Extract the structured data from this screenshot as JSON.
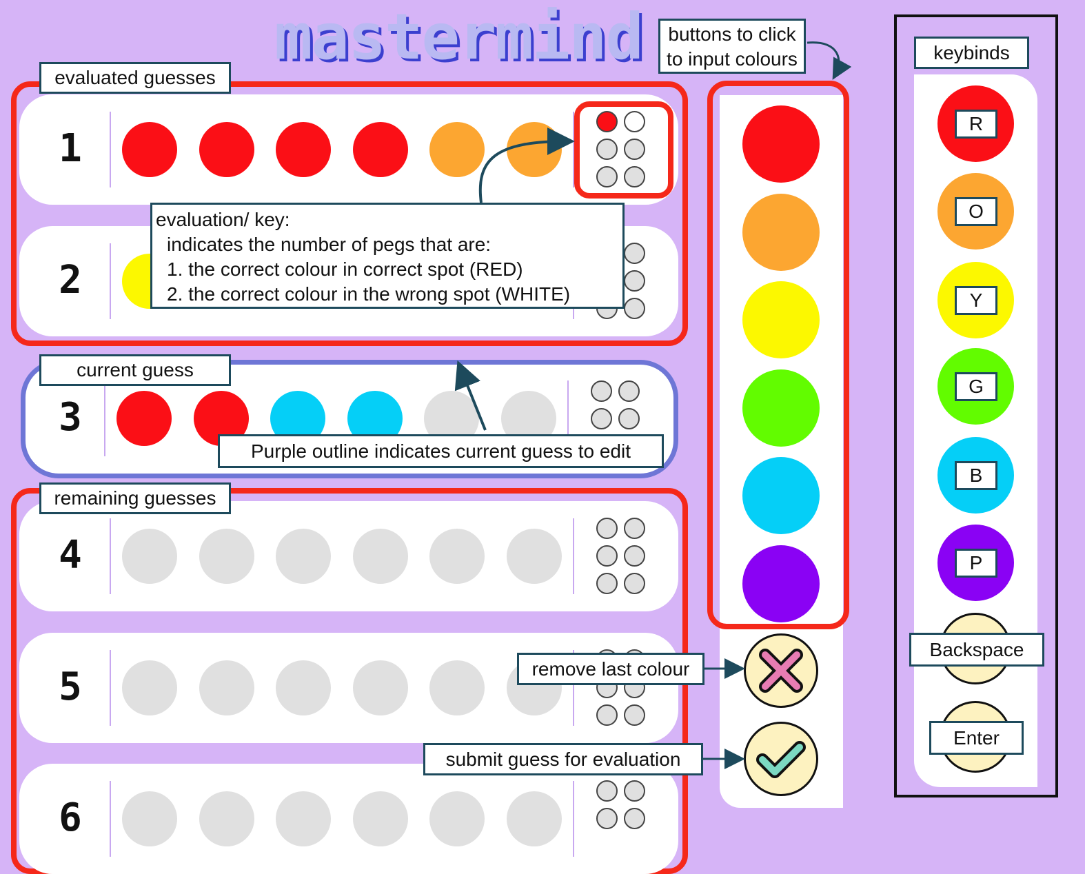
{
  "app": {
    "title": "mastermind"
  },
  "labels": {
    "evaluated": "evaluated guesses",
    "current": "current guess",
    "remaining": "remaining guesses",
    "buttons_line1": "buttons to click",
    "buttons_line2": "to input colours",
    "keybinds": "keybinds",
    "evaluation": {
      "line1": "evaluation/ key:",
      "line2": "indicates the number of pegs that are:",
      "line3": "1. the correct colour in correct spot (RED)",
      "line4": "2. the correct colour in the wrong spot (WHITE)"
    },
    "purple_outline": "Purple outline indicates current guess to edit",
    "remove_last": "remove last colour",
    "submit": "submit guess for evaluation"
  },
  "colors": {
    "red": "#fb0f16",
    "orange": "#fca631",
    "yellow": "#fcf800",
    "green": "#62fc00",
    "blue": "#05cff7",
    "purple": "#8a02f4",
    "empty": "#e0e0e0",
    "frame_red": "#f5281a",
    "current_outline": "#6e76d6"
  },
  "rows": [
    {
      "number": "1",
      "pegs": [
        "red",
        "red",
        "red",
        "red",
        "orange",
        "orange"
      ],
      "key": [
        "red",
        "white",
        "empty",
        "empty",
        "empty",
        "empty"
      ]
    },
    {
      "number": "2",
      "pegs": [
        "yellow",
        "empty",
        "empty",
        "empty",
        "empty",
        "empty"
      ],
      "key": [
        "white",
        "empty",
        "empty",
        "empty",
        "empty",
        "empty"
      ]
    },
    {
      "number": "3",
      "pegs": [
        "red",
        "red",
        "blue",
        "blue",
        "empty",
        "empty"
      ],
      "key": [
        "empty",
        "empty",
        "empty",
        "empty"
      ]
    },
    {
      "number": "4",
      "pegs": [
        "empty",
        "empty",
        "empty",
        "empty",
        "empty",
        "empty"
      ],
      "key": [
        "empty",
        "empty",
        "empty",
        "empty",
        "empty",
        "empty"
      ]
    },
    {
      "number": "5",
      "pegs": [
        "empty",
        "empty",
        "empty",
        "empty",
        "empty",
        "empty"
      ],
      "key": [
        "empty",
        "empty",
        "empty",
        "empty",
        "empty",
        "empty"
      ]
    },
    {
      "number": "6",
      "pegs": [
        "empty",
        "empty",
        "empty",
        "empty",
        "empty",
        "empty"
      ],
      "key": [
        "empty",
        "empty",
        "empty",
        "empty"
      ]
    }
  ],
  "colour_buttons": [
    "red",
    "orange",
    "yellow",
    "green",
    "blue",
    "purple"
  ],
  "keybinds": [
    {
      "key": "R",
      "color": "red"
    },
    {
      "key": "O",
      "color": "orange"
    },
    {
      "key": "Y",
      "color": "yellow"
    },
    {
      "key": "G",
      "color": "green"
    },
    {
      "key": "B",
      "color": "blue"
    },
    {
      "key": "P",
      "color": "purple"
    }
  ],
  "action_keys": {
    "backspace": "Backspace",
    "enter": "Enter"
  },
  "icons": {
    "remove": "x-icon",
    "submit": "check-icon"
  }
}
